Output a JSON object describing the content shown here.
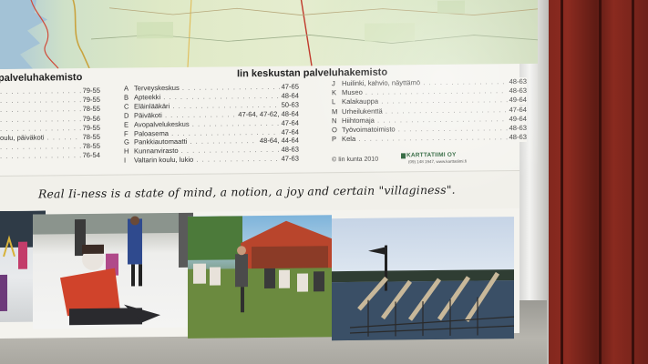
{
  "left_list": {
    "title": "palveluhakemisto",
    "rows": [
      {
        "name": "",
        "pages": "79-55"
      },
      {
        "name": "",
        "pages": "79-55"
      },
      {
        "name": "",
        "pages": "78-55"
      },
      {
        "name": "",
        "pages": "79-56"
      },
      {
        "name": "",
        "pages": "79-55"
      },
      {
        "name": "oulu, päiväkoti",
        "pages": "78-55"
      },
      {
        "name": "",
        "pages": "78-55"
      },
      {
        "name": "",
        "pages": "76-54"
      }
    ]
  },
  "right_list": {
    "title": "Iin keskustan palveluhakemisto",
    "col_a": [
      {
        "code": "A",
        "name": "Terveyskeskus",
        "pages": "47-65"
      },
      {
        "code": "B",
        "name": "Apteekki",
        "pages": "48-64"
      },
      {
        "code": "C",
        "name": "Eläinlääkäri",
        "pages": "50-63"
      },
      {
        "code": "D",
        "name": "Päiväkoti",
        "pages": "47-64, 47-62, 48-64"
      },
      {
        "code": "E",
        "name": "Avopalvelukeskus",
        "pages": "47-64"
      },
      {
        "code": "F",
        "name": "Paloasema",
        "pages": "47-64"
      },
      {
        "code": "G",
        "name": "Pankkiautomaatti",
        "pages": "48-64, 44-64"
      },
      {
        "code": "H",
        "name": "Kunnanvirasto",
        "pages": "48-63"
      },
      {
        "code": "I",
        "name": "Valtarin koulu, lukio",
        "pages": "47-63"
      }
    ],
    "col_b": [
      {
        "code": "J",
        "name": "Huilinki, kahvio, näyttämö",
        "pages": "48-63"
      },
      {
        "code": "K",
        "name": "Museo",
        "pages": "48-63"
      },
      {
        "code": "L",
        "name": "Kalakauppa",
        "pages": "49-64"
      },
      {
        "code": "M",
        "name": "Urheilukenttä",
        "pages": "47-64"
      },
      {
        "code": "N",
        "name": "Hiihtomaja",
        "pages": "49-64"
      },
      {
        "code": "O",
        "name": "Työvoimatoimisto",
        "pages": "48-63"
      },
      {
        "code": "P",
        "name": "Kela",
        "pages": "48-63"
      }
    ]
  },
  "credit": "© Iin kunta 2010",
  "logo": {
    "word": "KARTTATIIMI OY",
    "sub": "(09) 148 1947, www.karttatiimi.fi"
  },
  "slogan": "Real Ii-ness is a state of mind, a notion, a joy and certain \"villaginess\".",
  "colors": {
    "board": "#f4f3ee",
    "wood": "#8c2b20",
    "map_water": "#a9c6d8",
    "logo_green": "#1f5a2e"
  }
}
